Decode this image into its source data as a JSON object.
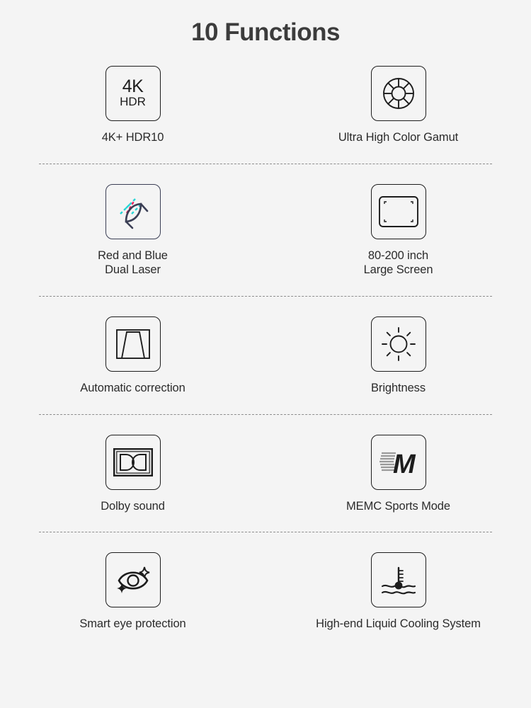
{
  "page": {
    "title": "10 Functions",
    "background_color": "#f4f4f4",
    "text_color": "#2b2b2b",
    "divider_color": "#8d8d8d"
  },
  "icon_colors": {
    "outline": "#1d1d1d",
    "navy": "#3b3f55",
    "laser_red": "#e8225f",
    "laser_cyan": "#25d6d6",
    "memc_gray": "#9a9a9a",
    "memc_black": "#1d1d1d"
  },
  "features": [
    {
      "id": "4k-hdr10",
      "label": "4K+ HDR10",
      "icon": "4k-hdr-icon",
      "icon_text_main": "4K",
      "icon_text_sub": "HDR"
    },
    {
      "id": "ultra-high-color-gamut",
      "label": "Ultra High Color Gamut",
      "icon": "color-wheel-icon"
    },
    {
      "id": "red-blue-dual-laser",
      "label": "Red and Blue\nDual Laser",
      "icon": "dual-laser-icon"
    },
    {
      "id": "large-screen",
      "label": "80-200 inch\nLarge Screen",
      "icon": "screen-icon"
    },
    {
      "id": "automatic-correction",
      "label": "Automatic correction",
      "icon": "keystone-correction-icon"
    },
    {
      "id": "brightness",
      "label": "Brightness",
      "icon": "sun-brightness-icon"
    },
    {
      "id": "dolby-sound",
      "label": "Dolby sound",
      "icon": "dolby-logo-icon"
    },
    {
      "id": "memc-sports-mode",
      "label": "MEMC Sports Mode",
      "icon": "memc-motion-icon",
      "icon_text": "M"
    },
    {
      "id": "smart-eye-protection",
      "label": "Smart eye protection",
      "icon": "eye-protection-icon"
    },
    {
      "id": "liquid-cooling-system",
      "label": "High-end Liquid Cooling System",
      "icon": "liquid-cooling-thermometer-icon"
    }
  ]
}
